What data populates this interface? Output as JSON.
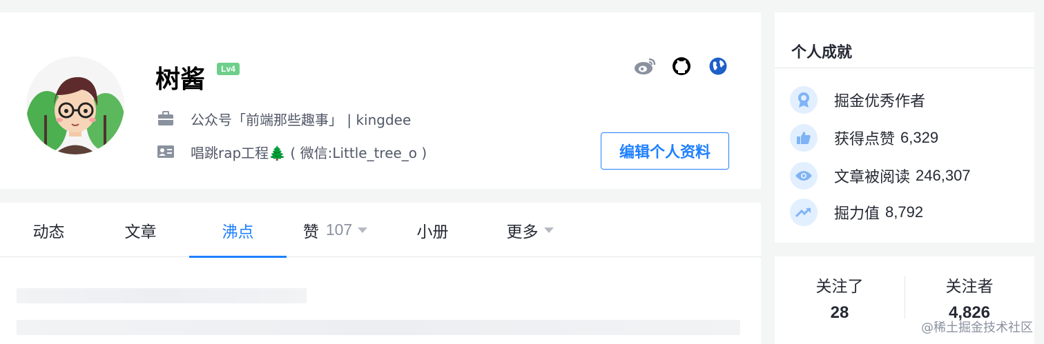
{
  "profile": {
    "username": "树酱",
    "level": "Lv4",
    "job": "公众号「前端那些趣事」 | kingdee",
    "bio": "唱跳rap工程🌲 ( 微信:Little_tree_o )",
    "edit_button": "编辑个人资料",
    "social_icons": [
      "weibo-icon",
      "github-icon",
      "globe-icon"
    ]
  },
  "tabs": [
    {
      "label": "动态",
      "active": false
    },
    {
      "label": "文章",
      "active": false
    },
    {
      "label": "沸点",
      "active": true
    },
    {
      "label": "赞",
      "count": "107",
      "dropdown": true
    },
    {
      "label": "小册",
      "active": false
    },
    {
      "label": "更多",
      "dropdown": true
    }
  ],
  "achievements": {
    "title": "个人成就",
    "items": [
      {
        "icon": "award-icon",
        "label": "掘金优秀作者",
        "value": ""
      },
      {
        "icon": "thumb-up-icon",
        "label": "获得点赞",
        "value": "6,329"
      },
      {
        "icon": "eye-icon",
        "label": "文章被阅读",
        "value": "246,307"
      },
      {
        "icon": "trend-icon",
        "label": "掘力值",
        "value": "8,792"
      }
    ]
  },
  "follow": {
    "following_label": "关注了",
    "following_count": "28",
    "followers_label": "关注者",
    "followers_count": "4,826"
  },
  "watermark": "@稀土掘金技术社区",
  "colors": {
    "accent": "#1e80ff",
    "level_badge": "#6ecf8a",
    "icon_bg": "#e1efff"
  }
}
